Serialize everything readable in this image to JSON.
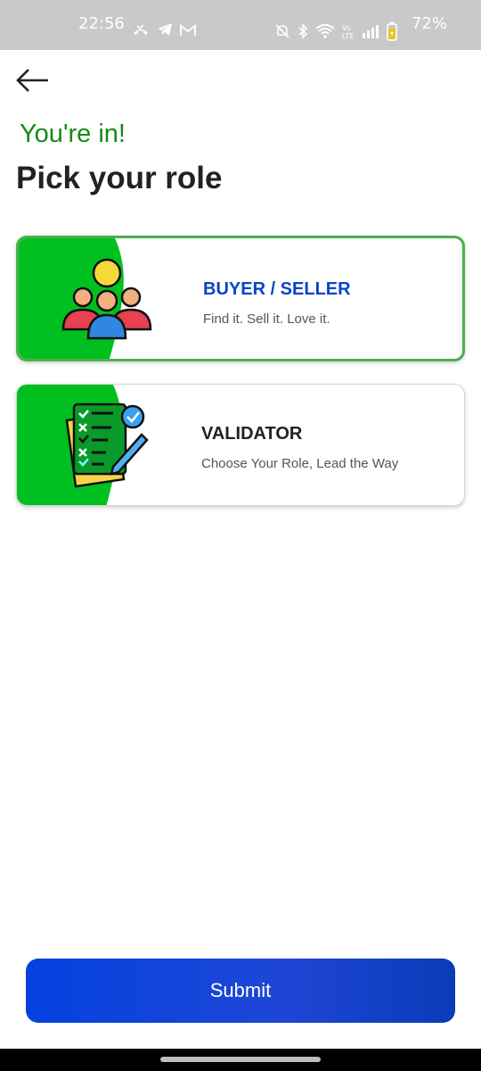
{
  "status_bar": {
    "time": "22:56",
    "battery": "72%",
    "left_icons": [
      "missed-call-icon",
      "telegram-icon",
      "gmail-icon"
    ],
    "right_icons": [
      "mute-icon",
      "bluetooth-icon",
      "wifi-icon",
      "volte-icon",
      "signal-icon",
      "battery-icon"
    ]
  },
  "header": {
    "back_icon": "arrow-left-icon",
    "subtitle": "You're in!",
    "title": "Pick your role"
  },
  "roles": [
    {
      "name": "BUYER / SELLER",
      "description": "Find it. Sell it. Love it.",
      "icon": "people-group-icon",
      "selected": true
    },
    {
      "name": "VALIDATOR",
      "description": "Choose Your Role, Lead the Way",
      "icon": "checklist-icon",
      "selected": false
    }
  ],
  "submit_label": "Submit",
  "colors": {
    "accent_green": "#00c020",
    "subtitle_green": "#178a17",
    "selected_border": "#4caf50",
    "selected_text": "#0a44c8",
    "button_blue": "#0442e0"
  }
}
